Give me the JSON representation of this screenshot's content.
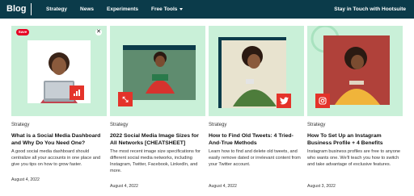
{
  "nav": {
    "logo": "Blog",
    "items": [
      {
        "label": "Strategy"
      },
      {
        "label": "News"
      },
      {
        "label": "Experiments"
      },
      {
        "label": "Free Tools"
      }
    ],
    "cta": "Stay in Touch with Hootsuite"
  },
  "cards": [
    {
      "category": "Strategy",
      "title": "What is a Social Media Dashboard and Why Do You Need One?",
      "excerpt": "A good social media dashboard should centralize all your accounts in one place and give you tips on how to grow faster.",
      "date": "August 4, 2022",
      "badge_icon": "bar-chart-icon",
      "pin_label": "Save"
    },
    {
      "category": "Strategy",
      "title": "2022 Social Media Image Sizes for All Networks [CHEATSHEET]",
      "excerpt": "The most recent image size specifications for different social media networks, including Instagram, Twitter, Facebook, LinkedIn, and more.",
      "date": "August 4, 2022",
      "badge_icon": "resize-arrows-icon"
    },
    {
      "category": "Strategy",
      "title": "How to Find Old Tweets: 4 Tried-And-True Methods",
      "excerpt": "Learn how to find and delete old tweets, and easily remove dated or irrelevant content from your Twitter account.",
      "date": "August 4, 2022",
      "badge_icon": "twitter-icon"
    },
    {
      "category": "Strategy",
      "title": "How To Set Up an Instagram Business Profile + 4 Benefits",
      "excerpt": "Instagram business profiles are free to anyone who wants one. We'll teach you how to switch and take advantage of exclusive features.",
      "date": "August 3, 2022",
      "badge_icon": "instagram-icon"
    }
  ],
  "colors": {
    "nav_bg": "#0b3b4a",
    "mint": "#c9f0d8",
    "badge_red": "#e4332a"
  }
}
